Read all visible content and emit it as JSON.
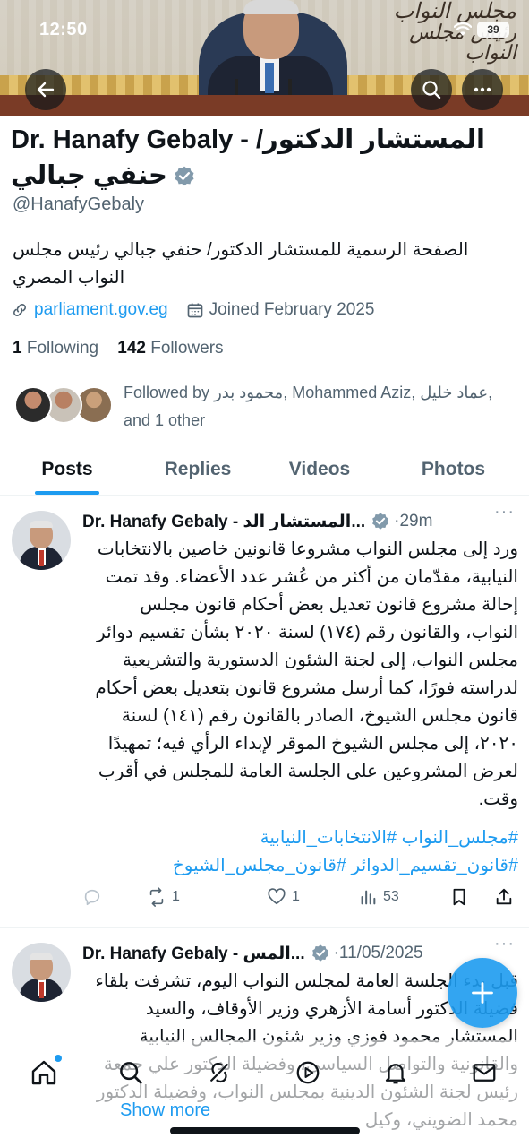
{
  "status_bar": {
    "time": "12:50",
    "battery": "39"
  },
  "banner": {
    "calligraphy_line1": "مجلس النواب",
    "calligraphy_line2": "رئيس مجلس النواب"
  },
  "header_icons": {
    "back": "arrow-left-icon",
    "search": "search-icon",
    "more": "more-horizontal-icon"
  },
  "profile": {
    "name": "Dr. Hanafy Gebaly - المستشار الدكتور/ حنفي جبالي",
    "handle": "@HanafyGebaly",
    "bio": "الصفحة الرسمية للمستشار الدكتور/ حنفي جبالي رئيس مجلس النواب المصري",
    "website": "parliament.gov.eg",
    "joined": "Joined February 2025",
    "following_count": "1",
    "following_label": "Following",
    "followers_count": "142",
    "followers_label": "Followers",
    "followed_by": "Followed by محمود بدر, Mohammed Aziz, عماد خليل, and 1 other"
  },
  "tabs": [
    {
      "label": "Posts",
      "active": true
    },
    {
      "label": "Replies",
      "active": false
    },
    {
      "label": "Videos",
      "active": false
    },
    {
      "label": "Photos",
      "active": false
    }
  ],
  "tweets": [
    {
      "name": "Dr. Hanafy Gebaly - المستشار الد...",
      "time": "·29m",
      "text": "ورد إلى مجلس النواب مشروعا قانونين خاصين بالانتخابات النيابية، مقدّمان من أكثر من عُشر عدد الأعضاء. وقد تمت إحالة مشروع قانون تعديل بعض أحكام قانون مجلس النواب، والقانون رقم (١٧٤) لسنة ٢٠٢٠ بشأن تقسيم دوائر مجلس النواب، إلى لجنة الشئون الدستورية والتشريعية لدراسته فورًا، كما أرسل مشروع قانون بتعديل بعض أحكام قانون مجلس الشيوخ، الصادر بالقانون رقم (١٤١) لسنة ٢٠٢٠، إلى مجلس الشيوخ الموقر لإبداء الرأي فيه؛ تمهيدًا لعرض المشروعين على الجلسة العامة للمجلس في أقرب وقت.",
      "hashtags_line1": "#مجلس_النواب #الانتخابات_النيابية",
      "hashtags_line2": "#قانون_تقسيم_الدوائر #قانون_مجلس_الشيوخ",
      "retweets": "1",
      "likes": "1",
      "views": "53"
    },
    {
      "name": "Dr. Hanafy Gebaly - المس...",
      "time": "·11/05/2025",
      "text": "قبل بدء الجلسة العامة لمجلس النواب اليوم، تشرفت بلقاء فضيلة الدكتور أسامة الأزهري وزير الأوقاف، والسيد المستشار محمود فوزي وزير شئون المجالس النيابية والقانونية والتواصل السياسي، وفضيلة الدكتور علي جمعة رئيس لجنة الشئون الدينية بمجلس النواب، وفضيلة الدكتور محمد الضويني، وكيل",
      "show_more": "Show more"
    }
  ],
  "bottom_nav": [
    "home-icon",
    "search-icon",
    "grok-icon",
    "communities-icon",
    "notifications-icon",
    "messages-icon"
  ],
  "colors": {
    "accent": "#1d9bf0",
    "text": "#0f1419",
    "muted": "#536471"
  }
}
